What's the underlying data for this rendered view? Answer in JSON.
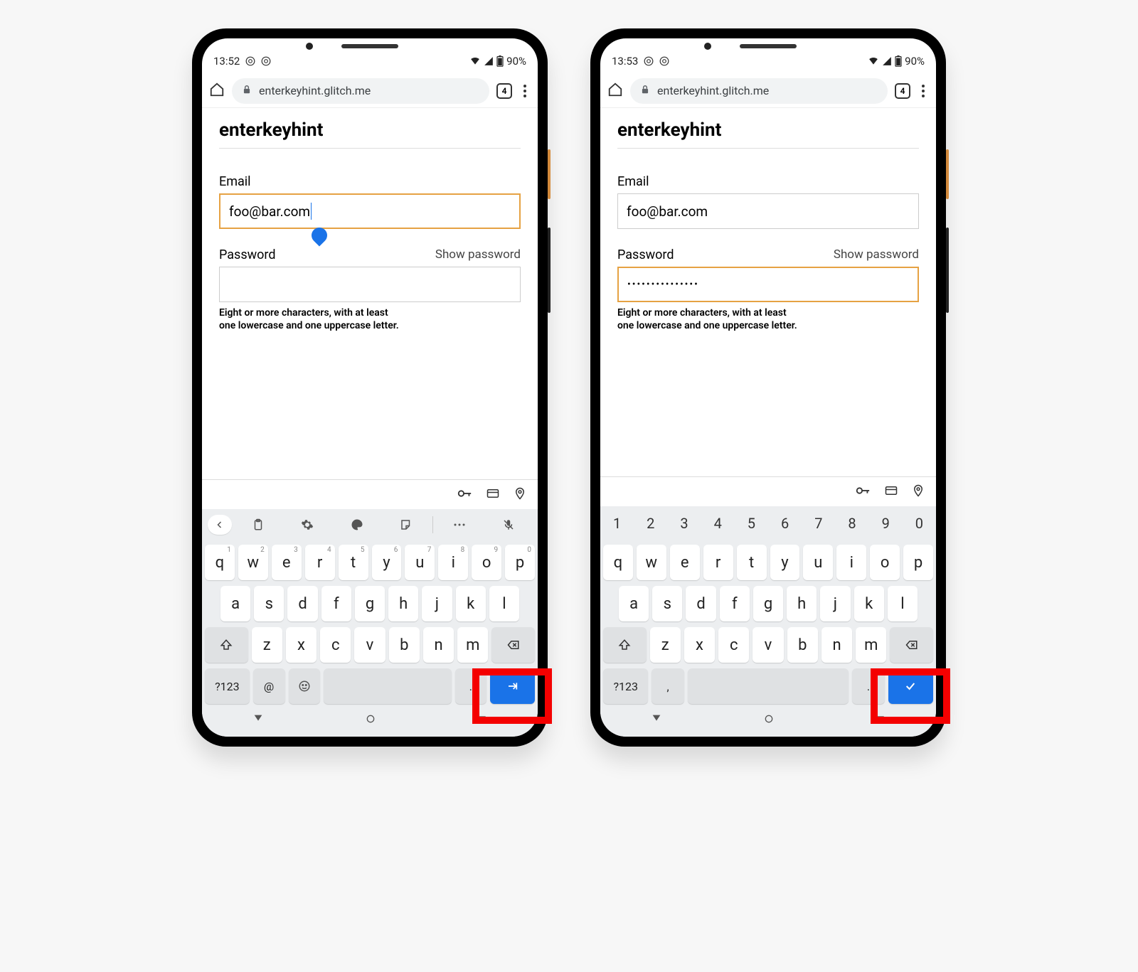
{
  "phones": [
    {
      "statusbar": {
        "time": "13:52",
        "battery": "90%"
      },
      "addressbar": {
        "url": "enterkeyhint.glitch.me",
        "tabcount": "4"
      },
      "page": {
        "heading": "enterkeyhint",
        "email_label": "Email",
        "email_value": "foo@bar.com",
        "email_focused": true,
        "password_label": "Password",
        "show_password": "Show password",
        "password_value": "",
        "password_focused": false,
        "hint_line1": "Eight or more characters, with at least",
        "hint_line2": "one lowercase and one uppercase letter."
      },
      "keyboard": {
        "has_number_row": false,
        "has_toolbar": true,
        "row1": [
          "q",
          "w",
          "e",
          "r",
          "t",
          "y",
          "u",
          "i",
          "o",
          "p"
        ],
        "sups": [
          "1",
          "2",
          "3",
          "4",
          "5",
          "6",
          "7",
          "8",
          "9",
          "0"
        ],
        "row2": [
          "a",
          "s",
          "d",
          "f",
          "g",
          "h",
          "j",
          "k",
          "l"
        ],
        "row3": [
          "z",
          "x",
          "c",
          "v",
          "b",
          "n",
          "m"
        ],
        "bottom": {
          "sym": "?123",
          "left1": "@",
          "period": ".",
          "enter_icon": "next"
        }
      }
    },
    {
      "statusbar": {
        "time": "13:53",
        "battery": "90%"
      },
      "addressbar": {
        "url": "enterkeyhint.glitch.me",
        "tabcount": "4"
      },
      "page": {
        "heading": "enterkeyhint",
        "email_label": "Email",
        "email_value": "foo@bar.com",
        "email_focused": false,
        "password_label": "Password",
        "show_password": "Show password",
        "password_value": "•••••••••••••••",
        "password_focused": true,
        "hint_line1": "Eight or more characters, with at least",
        "hint_line2": "one lowercase and one uppercase letter."
      },
      "keyboard": {
        "has_number_row": true,
        "has_toolbar": false,
        "numbers": [
          "1",
          "2",
          "3",
          "4",
          "5",
          "6",
          "7",
          "8",
          "9",
          "0"
        ],
        "row1": [
          "q",
          "w",
          "e",
          "r",
          "t",
          "y",
          "u",
          "i",
          "o",
          "p"
        ],
        "row2": [
          "a",
          "s",
          "d",
          "f",
          "g",
          "h",
          "j",
          "k",
          "l"
        ],
        "row3": [
          "z",
          "x",
          "c",
          "v",
          "b",
          "n",
          "m"
        ],
        "bottom": {
          "sym": "?123",
          "left1": ",",
          "period": ".",
          "enter_icon": "done"
        }
      }
    }
  ]
}
